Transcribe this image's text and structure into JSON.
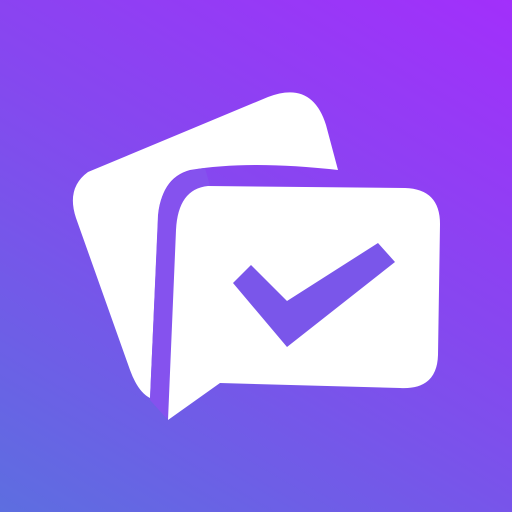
{
  "app_icon": {
    "icon_name": "chat-check-icon",
    "colors": {
      "gradient_top_right": "#a22ffb",
      "gradient_middle": "#8548ef",
      "gradient_bottom_left": "#5d6ee0",
      "bubble_fill": "#ffffff",
      "separator": "#7f55ee",
      "checkmark": "#7a56ea"
    }
  }
}
